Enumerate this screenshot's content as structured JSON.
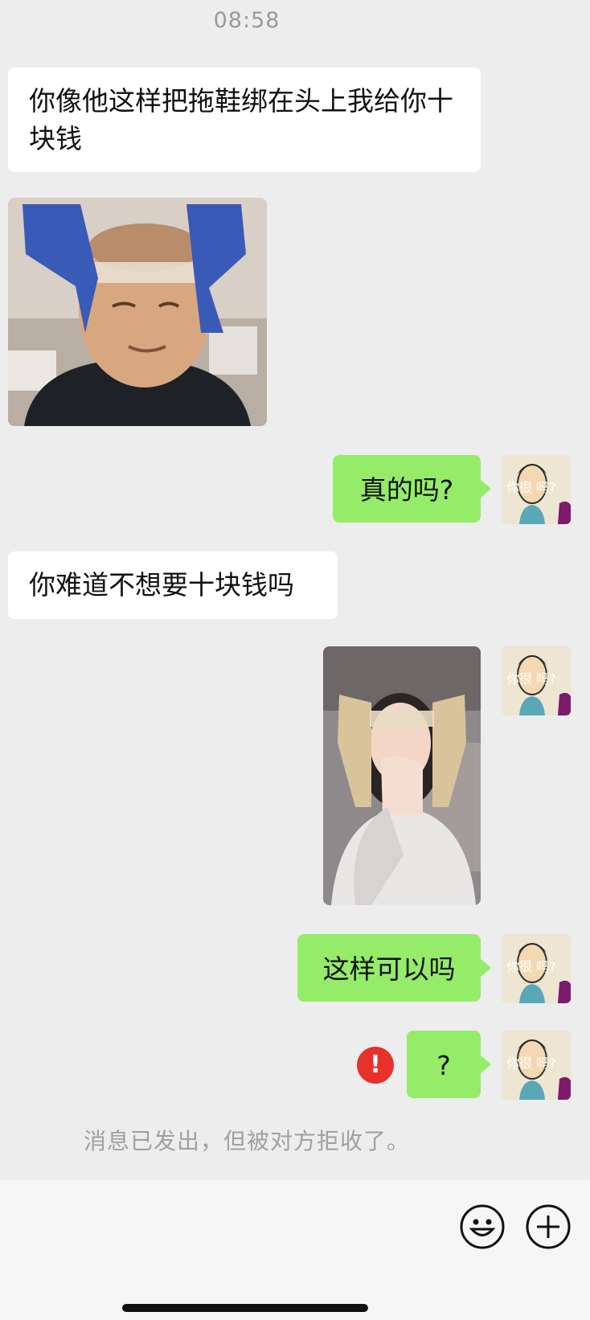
{
  "status": {
    "time": "08:58"
  },
  "messages": [
    {
      "side": "in",
      "type": "text",
      "text": "你像他这样把拖鞋绑在头上我给你十块钱"
    },
    {
      "side": "in",
      "type": "image"
    },
    {
      "side": "out",
      "type": "text",
      "text": "真的吗?"
    },
    {
      "side": "in",
      "type": "text",
      "text": "你难道不想要十块钱吗"
    },
    {
      "side": "out",
      "type": "image"
    },
    {
      "side": "out",
      "type": "text",
      "text": "这样可以吗"
    },
    {
      "side": "out",
      "type": "text",
      "text": "?",
      "error": "!"
    }
  ],
  "system_notice": "消息已发出，但被对方拒收了。",
  "avatar": {
    "caption": "你很 吗?"
  },
  "input_bar": {
    "icons": [
      "emoji-icon",
      "plus-icon"
    ]
  },
  "colors": {
    "outgoing": "#95ec69",
    "incoming": "#ffffff",
    "background": "#ededed",
    "error": "#e7312a"
  }
}
